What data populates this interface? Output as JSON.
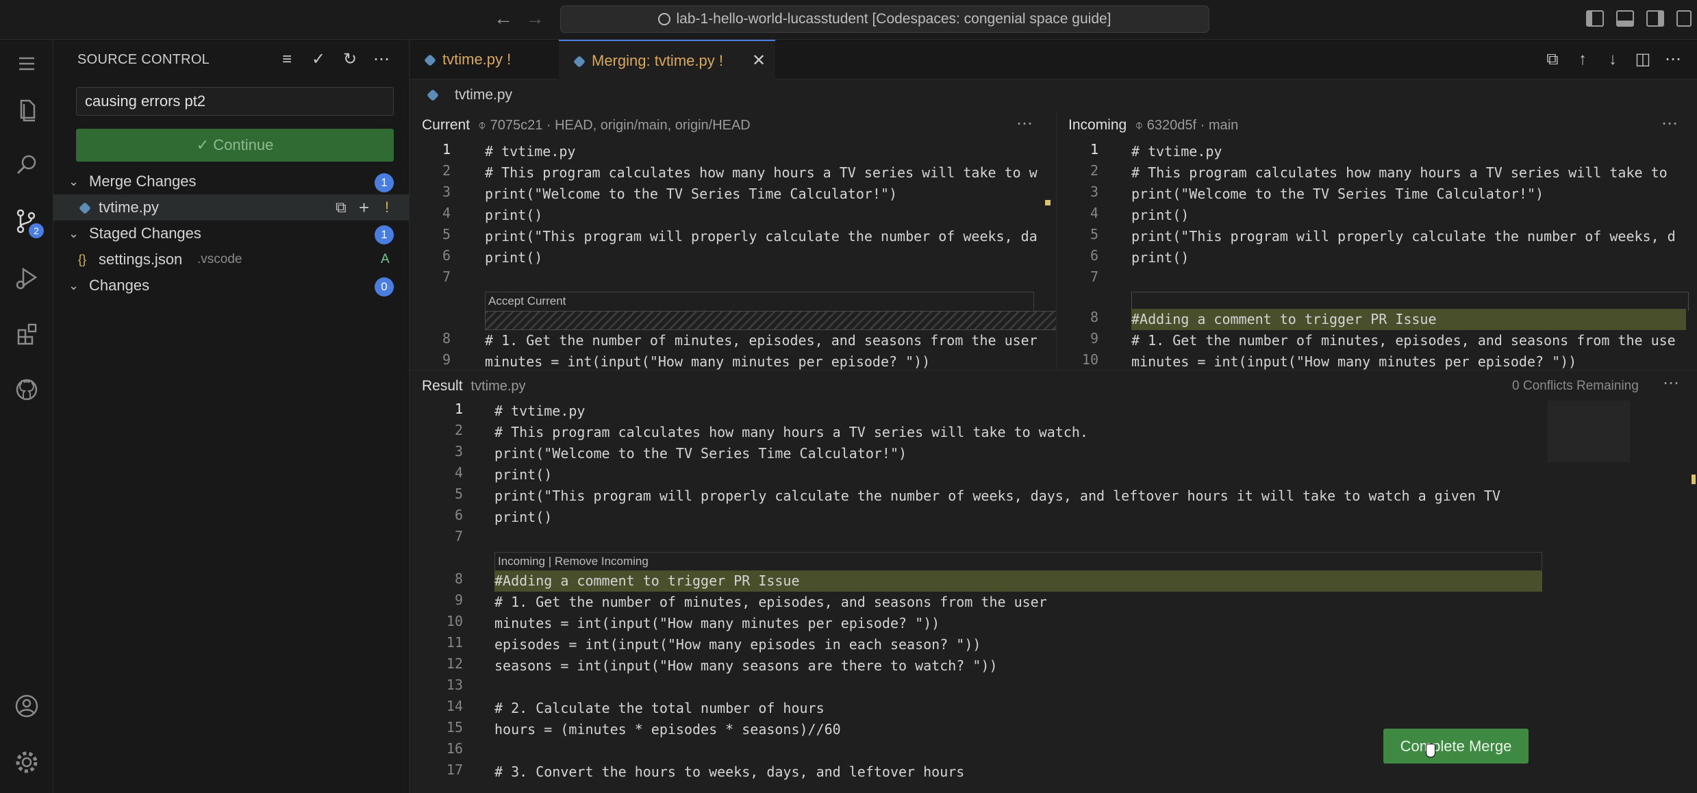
{
  "titlebar": {
    "command_center": "lab-1-hello-world-lucasstudent [Codespaces: congenial space guide]"
  },
  "activity": {
    "scm_badge": "2"
  },
  "sidebar": {
    "title": "SOURCE CONTROL",
    "commit_message": "causing errors pt2",
    "continue_label": "✓ Continue",
    "groups": [
      {
        "label": "Merge Changes",
        "count": "1"
      },
      {
        "label": "Staged Changes",
        "count": "1"
      },
      {
        "label": "Changes",
        "count": "0"
      }
    ],
    "merge_file": {
      "name": "tvtime.py",
      "status": "!"
    },
    "staged_file": {
      "name": "settings.json",
      "folder": ".vscode",
      "status": "A"
    }
  },
  "tabs": [
    {
      "label": "tvtime.py",
      "status": "!"
    },
    {
      "label": "Merging: tvtime.py",
      "status": "!"
    }
  ],
  "breadcrumb": "tvtime.py",
  "current": {
    "title": "Current",
    "meta": "⌽ 7075c21 · HEAD, origin/main, origin/HEAD",
    "accept_label": "Accept Current",
    "lines": [
      "1",
      "2",
      "3",
      "4",
      "5",
      "6",
      "7",
      "8",
      "9"
    ],
    "code": [
      "# tvtime.py",
      "# This program calculates how many hours a TV series will take to w",
      "print(\"Welcome to the TV Series Time Calculator!\")",
      "print()",
      "print(\"This program will properly calculate the number of weeks, da",
      "print()",
      "",
      "# 1. Get the number of minutes, episodes, and seasons from the user",
      "minutes = int(input(\"How many minutes per episode? \"))"
    ]
  },
  "incoming": {
    "title": "Incoming",
    "meta": "⌽ 6320d5f · main",
    "lines": [
      "1",
      "2",
      "3",
      "4",
      "5",
      "6",
      "7",
      "8",
      "9",
      "10"
    ],
    "code": [
      "# tvtime.py",
      "# This program calculates how many hours a TV series will take to",
      "print(\"Welcome to the TV Series Time Calculator!\")",
      "print()",
      "print(\"This program will properly calculate the number of weeks, d",
      "print()",
      "",
      "#Adding a comment to trigger PR Issue",
      "# 1. Get the number of minutes, episodes, and seasons from the use",
      "minutes = int(input(\"How many minutes per episode? \"))"
    ]
  },
  "result": {
    "title": "Result",
    "file": "tvtime.py",
    "conflicts": "0 Conflicts Remaining",
    "codelens": "Incoming | Remove Incoming",
    "lines": [
      "1",
      "2",
      "3",
      "4",
      "5",
      "6",
      "7",
      "8",
      "9",
      "10",
      "11",
      "12",
      "13",
      "14",
      "15",
      "16",
      "17"
    ],
    "code": [
      "# tvtime.py",
      "# This program calculates how many hours a TV series will take to watch.",
      "print(\"Welcome to the TV Series Time Calculator!\")",
      "print()",
      "print(\"This program will properly calculate the number of weeks, days, and leftover hours it will take to watch a given TV",
      "print()",
      "",
      "#Adding a comment to trigger PR Issue",
      "# 1. Get the number of minutes, episodes, and seasons from the user",
      "minutes = int(input(\"How many minutes per episode? \"))",
      "episodes = int(input(\"How many episodes in each season? \"))",
      "seasons = int(input(\"How many seasons are there to watch? \"))",
      "",
      "# 2. Calculate the total number of hours",
      "hours = (minutes * episodes * seasons)//60",
      "",
      "# 3. Convert the hours to weeks, days, and leftover hours"
    ]
  },
  "complete_merge_label": "Complete Merge"
}
